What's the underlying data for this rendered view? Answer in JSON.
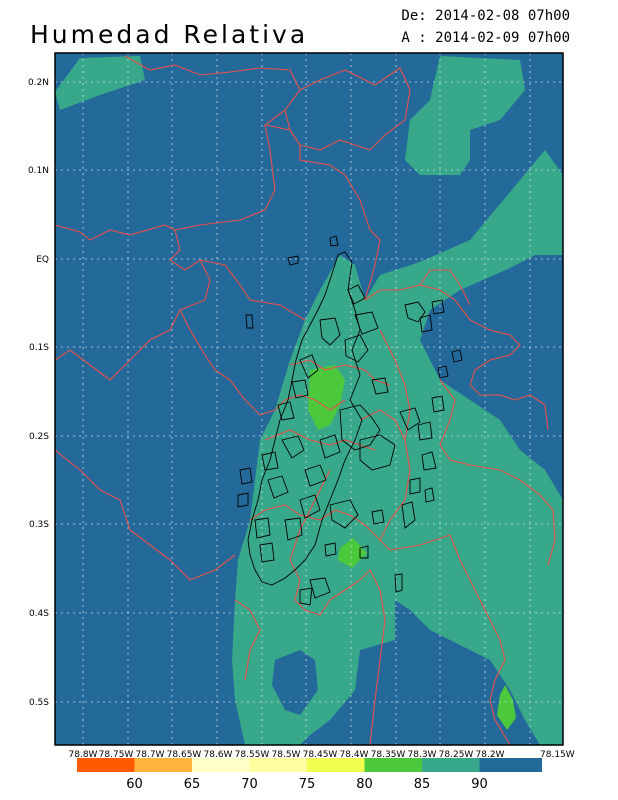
{
  "header": {
    "title": "Humedad Relativa",
    "date_from": "De: 2014-02-08 07h00",
    "date_to": "A : 2014-02-09 07h00"
  },
  "axes": {
    "y_ticks": [
      "0.2N",
      "0.1N",
      "EQ",
      "0.1S",
      "0.2S",
      "0.3S",
      "0.4S",
      "0.5S"
    ],
    "x_ticks": [
      "78.8W",
      "78.75W",
      "78.7W",
      "78.65W",
      "78.6W",
      "78.55W",
      "78.5W",
      "78.45W",
      "78.4W",
      "78.35W",
      "78.3W",
      "78.25W",
      "78.2W",
      "78.15W"
    ]
  },
  "colorbar": {
    "colors": [
      "#ff5a00",
      "#ffb43c",
      "#ffffc8",
      "#ffffa0",
      "#f0ff50",
      "#4bc83c",
      "#37a88a",
      "#236a9a"
    ],
    "labels": [
      "60",
      "65",
      "70",
      "75",
      "80",
      "85",
      "90"
    ]
  },
  "map": {
    "color_dark": "#236a9a",
    "color_mid": "#37a88a",
    "color_green": "#4bc83c",
    "border_color": "#e8504a",
    "urban_color": "#000000"
  }
}
